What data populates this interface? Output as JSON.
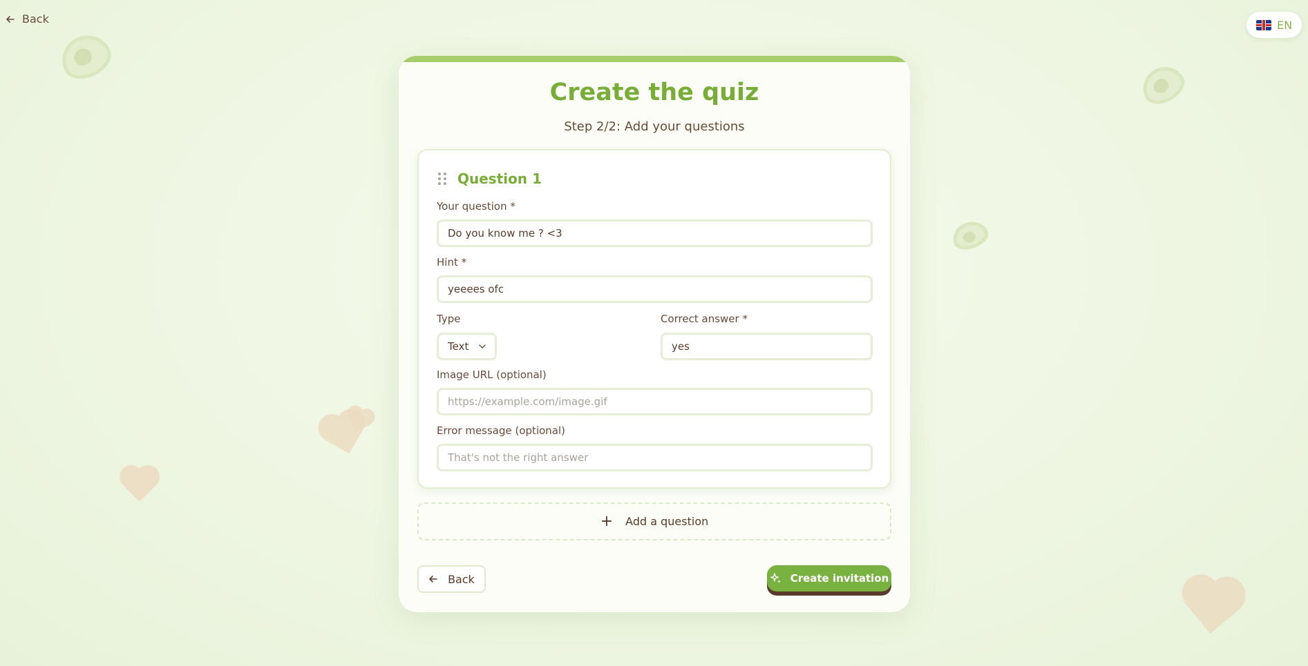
{
  "topbar": {
    "back_label": "Back",
    "lang_label": "EN",
    "flag_icon": "uk-flag-icon"
  },
  "card": {
    "title": "Create the quiz",
    "subtitle": "Step 2/2: Add your questions"
  },
  "question": {
    "heading": "Question 1",
    "question_label": "Your question *",
    "question_value": "Do you know me ? <3",
    "hint_label": "Hint *",
    "hint_value": "yeeees ofc",
    "type_label": "Type",
    "type_value": "Text",
    "answer_label": "Correct answer *",
    "answer_value": "yes",
    "image_label": "Image URL (optional)",
    "image_placeholder": "https://example.com/image.gif",
    "error_label": "Error message (optional)",
    "error_placeholder": "That's not the right answer"
  },
  "actions": {
    "add_question": "Add a question",
    "back": "Back",
    "create": "Create invitation"
  },
  "colors": {
    "accent": "#78ad38",
    "button": "#7ab242",
    "text": "#5b3a2a"
  }
}
